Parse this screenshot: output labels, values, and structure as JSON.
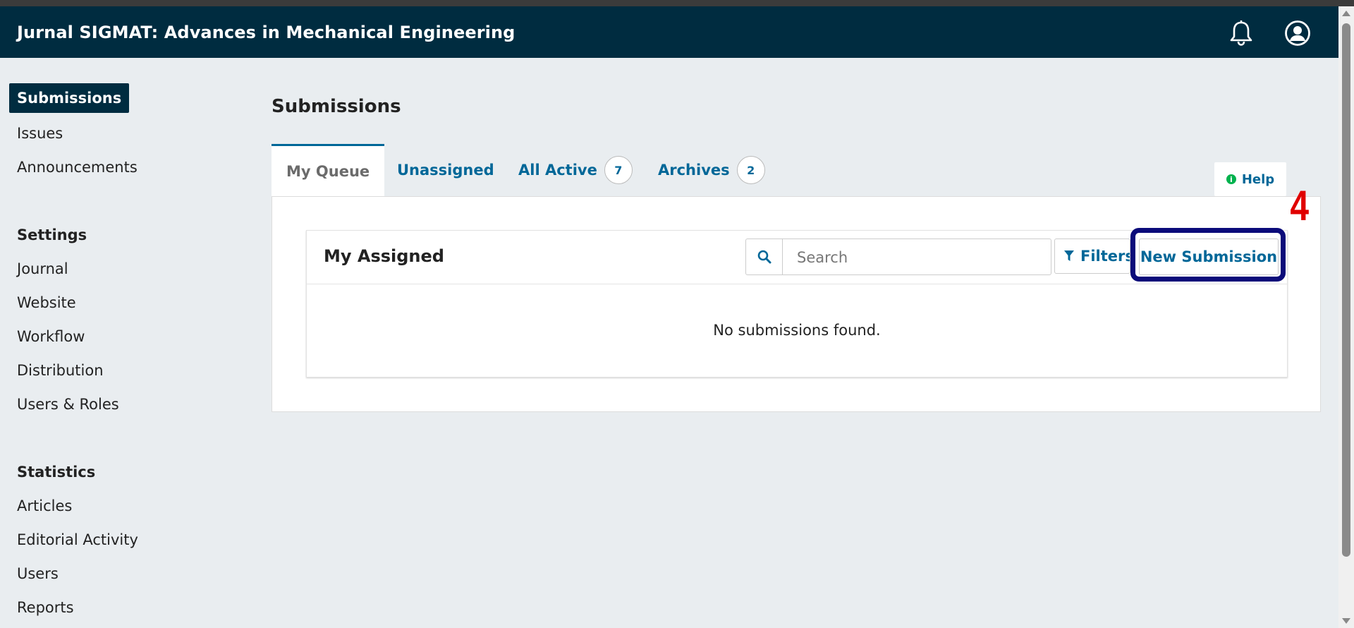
{
  "header": {
    "title": "Jurnal SIGMAT: Advances in Mechanical Engineering",
    "icons": [
      "bell-icon",
      "user-account-icon"
    ]
  },
  "sidebar": {
    "items": [
      "Submissions",
      "Issues",
      "Announcements"
    ],
    "settings_heading": "Settings",
    "settings_items": [
      "Journal",
      "Website",
      "Workflow",
      "Distribution",
      "Users & Roles"
    ],
    "statistics_heading": "Statistics",
    "statistics_items": [
      "Articles",
      "Editorial Activity",
      "Users",
      "Reports"
    ]
  },
  "main": {
    "title": "Submissions",
    "tabs": [
      {
        "label": "My Queue",
        "active": true
      },
      {
        "label": "Unassigned"
      },
      {
        "label": "All Active",
        "count": "7"
      },
      {
        "label": "Archives",
        "count": "2"
      }
    ],
    "help_label": "Help",
    "list": {
      "title": "My Assigned",
      "search_placeholder": "Search",
      "filters_label": "Filters",
      "new_submission_label": "New Submission",
      "empty_message": "No submissions found."
    }
  },
  "annotation": {
    "step_number": "4",
    "step_color": "#e00000",
    "box_color": "#0b0b7a"
  },
  "colors": {
    "header_bg": "#002c40",
    "link": "#006798",
    "page_bg": "#e9edf0"
  }
}
